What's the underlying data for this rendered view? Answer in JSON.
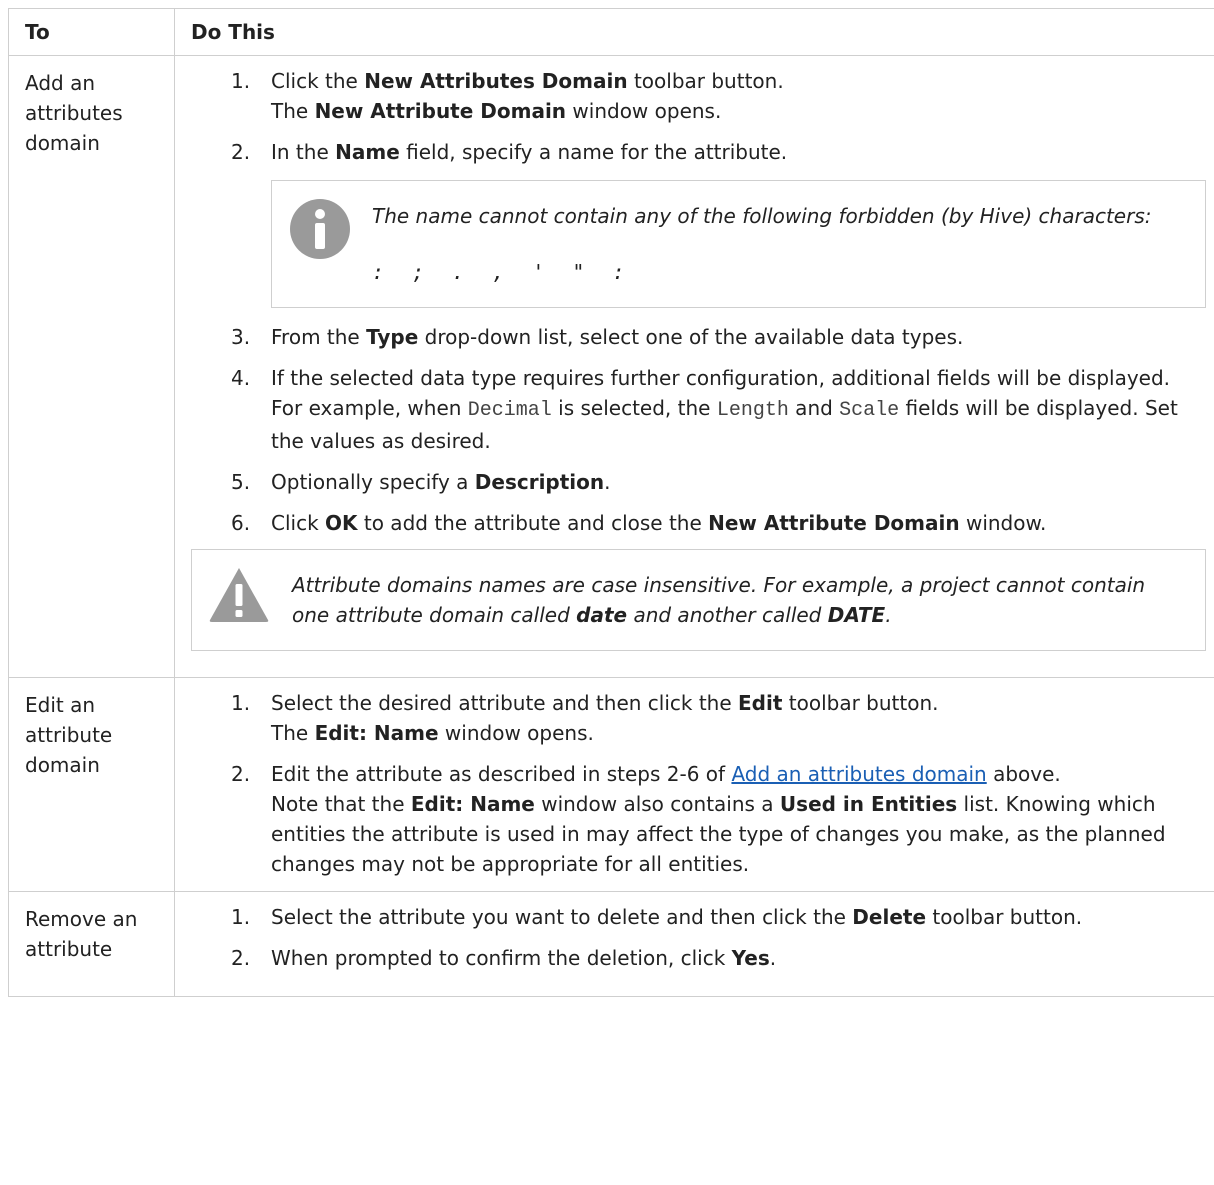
{
  "headers": {
    "to": "To",
    "do_this": "Do This"
  },
  "row1": {
    "to": "Add an attributes domain",
    "s1_a": "Click the ",
    "s1_b": "New Attributes Domain",
    "s1_c": " toolbar button.",
    "s1_d": "The ",
    "s1_e": "New Attribute Domain",
    "s1_f": " window opens.",
    "s2_a": "In the ",
    "s2_b": "Name",
    "s2_c": " field, specify a name for the attribute.",
    "note1_text": "The name cannot contain any of the following forbidden (by Hive) characters:",
    "note1_chars": ": ; . , ' \" :",
    "s3_a": "From the ",
    "s3_b": "Type",
    "s3_c": " drop-down list, select one of the available data types.",
    "s4_a": "If the selected data type requires further configuration, additional fields will be displayed. For example, when ",
    "s4_b": "Decimal",
    "s4_c": " is selected, the ",
    "s4_d": "Length",
    "s4_e": " and ",
    "s4_f": "Scale",
    "s4_g": " fields will be displayed. Set the values as desired.",
    "s5_a": "Optionally specify a ",
    "s5_b": "Description",
    "s5_c": ".",
    "s6_a": "Click ",
    "s6_b": "OK",
    "s6_c": " to add the attribute and close the ",
    "s6_d": "New Attribute Domain",
    "s6_e": " window.",
    "note2_a": "Attribute domains names are case insensitive. For example, a project cannot contain one attribute domain called ",
    "note2_b": "date",
    "note2_c": " and another called ",
    "note2_d": "DATE",
    "note2_e": "."
  },
  "row2": {
    "to": "Edit an attribute domain",
    "s1_a": "Select the desired attribute and then click the ",
    "s1_b": "Edit",
    "s1_c": " toolbar button.",
    "s1_d": "The ",
    "s1_e": "Edit: Name",
    "s1_f": " window opens.",
    "s2_a": "Edit the attribute as described in steps 2-6 of ",
    "s2_link": "Add an attributes domain",
    "s2_b": " above.",
    "s2_c": "Note that the ",
    "s2_d": "Edit: Name",
    "s2_e": " window also contains a ",
    "s2_f": "Used in Entities",
    "s2_g": " list. Knowing which entities the attribute is used in may affect the type of changes you make, as the planned changes may not be appropriate for all entities."
  },
  "row3": {
    "to": "Remove an attribute",
    "s1_a": "Select the attribute you want to delete and then click the ",
    "s1_b": "Delete",
    "s1_c": " toolbar button.",
    "s2_a": "When prompted to confirm the deletion, click ",
    "s2_b": "Yes",
    "s2_c": "."
  },
  "nums": [
    "1.",
    "2.",
    "3.",
    "4.",
    "5.",
    "6."
  ],
  "icons": {
    "note": "info-icon",
    "warning": "warning-icon"
  }
}
